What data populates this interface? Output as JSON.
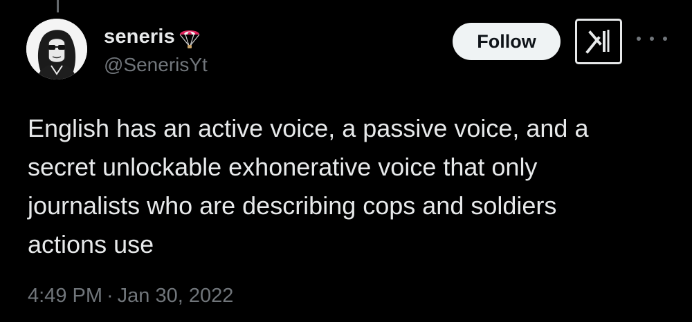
{
  "author": {
    "display_name": "seneris",
    "handle": "@SenerisYt",
    "badge_icon": "parachute-icon",
    "avatar_icon": "avatar-icon"
  },
  "actions": {
    "follow_label": "Follow",
    "grok_icon": "grok-icon",
    "more_icon": "more-icon"
  },
  "tweet": {
    "text": "English has an active voice, a passive voice, and a\nsecret unlockable exhonerative voice that only\njournalists who are describing cops and soldiers\nactions use",
    "time": "4:49 PM",
    "separator": "·",
    "date": "Jan 30, 2022"
  },
  "colors": {
    "background": "#000000",
    "text_primary": "#e7e9ea",
    "text_secondary": "#71767b",
    "follow_bg": "#eff3f4"
  }
}
